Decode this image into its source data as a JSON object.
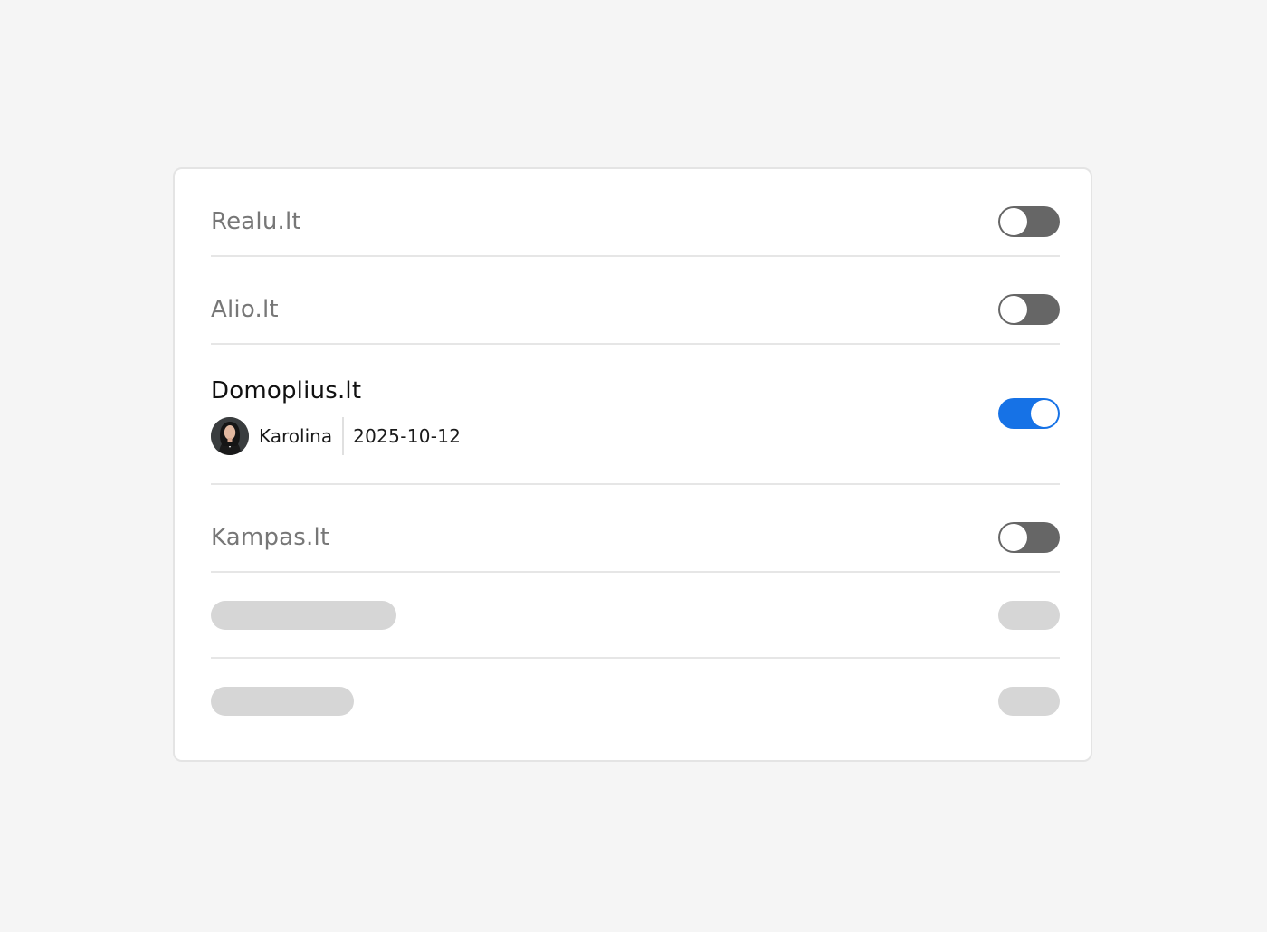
{
  "integrations": [
    {
      "name": "Realu.lt",
      "enabled": false
    },
    {
      "name": "Alio.lt",
      "enabled": false
    },
    {
      "name": "Domoplius.lt",
      "enabled": true,
      "user": "Karolina",
      "date": "2025-10-12"
    },
    {
      "name": "Kampas.lt",
      "enabled": false
    }
  ],
  "loading_rows": 2,
  "colors": {
    "toggle_on": "#1672e6",
    "toggle_off": "#666666",
    "skeleton": "#d6d6d6",
    "page_background": "#f5f5f5"
  },
  "icons": {
    "avatar": "user-avatar"
  }
}
